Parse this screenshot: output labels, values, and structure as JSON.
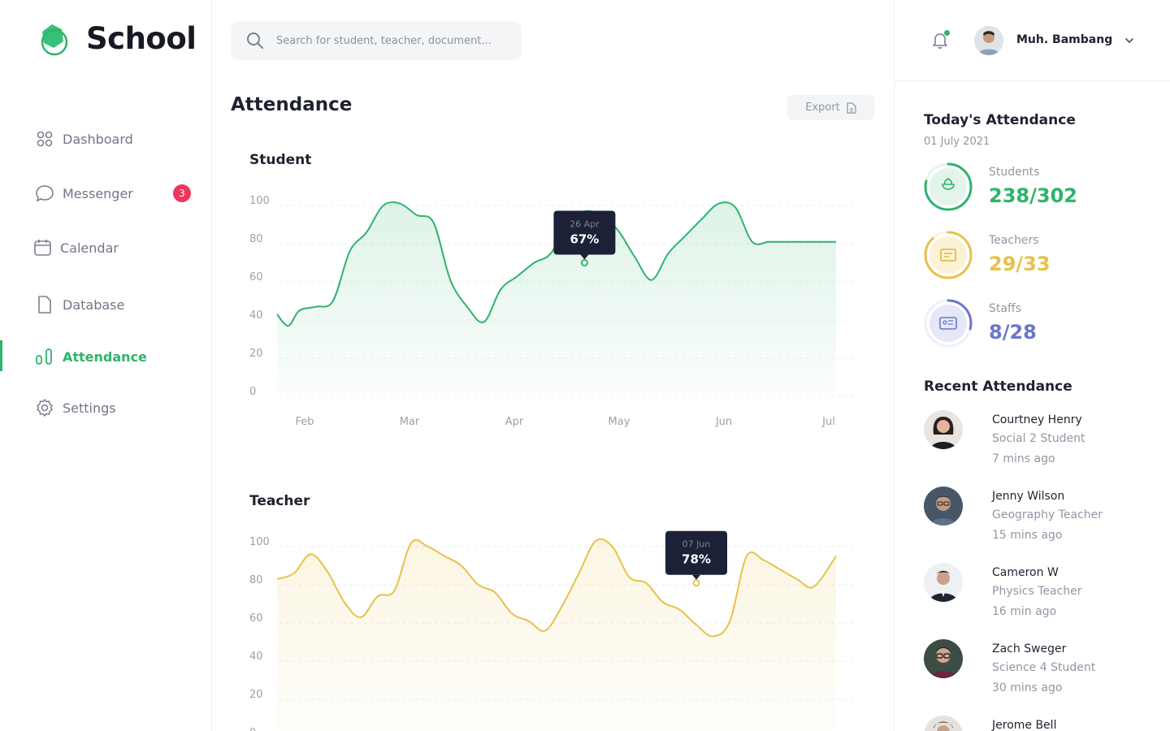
{
  "brand": {
    "name": "School",
    "accent": "#2fb36b"
  },
  "sidebar": {
    "items": [
      {
        "label": "Dashboard",
        "icon": "grid-icon",
        "active": false
      },
      {
        "label": "Messenger",
        "icon": "chat-bubble-icon",
        "active": false,
        "badge": "3"
      },
      {
        "label": "Calendar",
        "icon": "calendar-icon",
        "active": false
      },
      {
        "label": "Database",
        "icon": "file-icon",
        "active": false
      },
      {
        "label": "Attendance",
        "icon": "bar-chart-icon",
        "active": true
      },
      {
        "label": "Settings",
        "icon": "gear-icon",
        "active": false
      }
    ]
  },
  "search": {
    "placeholder": "Search for student, teacher, document...",
    "value": ""
  },
  "page": {
    "title": "Attendance",
    "export_label": "Export"
  },
  "header": {
    "user_name": "Muh. Bambang",
    "notification_dot": true
  },
  "chart_data": [
    {
      "type": "area",
      "title": "Student",
      "color": "#2fb36b",
      "x_ticks": [
        "Feb",
        "Mar",
        "Apr",
        "May",
        "Jun",
        "Jul"
      ],
      "y_ticks": [
        "100",
        "80",
        "60",
        "40",
        "20",
        "0"
      ],
      "ylim": [
        0,
        100
      ],
      "x": [
        0,
        0.1,
        0.2,
        0.35,
        0.5,
        0.65,
        0.8,
        0.95,
        1.1,
        1.25,
        1.4,
        1.55,
        1.7,
        1.85,
        2.0,
        2.15,
        2.3,
        2.45,
        2.6,
        2.75,
        2.9,
        3.05,
        3.2,
        3.35,
        3.5,
        3.65,
        3.8,
        3.95,
        4.1,
        4.25,
        4.4,
        4.55,
        4.7,
        4.85,
        5.0
      ],
      "values": [
        40,
        34,
        42,
        44,
        47,
        73,
        83,
        97,
        98,
        92,
        88,
        58,
        44,
        36,
        53,
        60,
        67,
        72,
        89,
        94,
        92,
        84,
        70,
        58,
        72,
        81,
        90,
        98,
        96,
        78,
        78,
        78,
        78,
        78,
        78
      ],
      "tooltip": {
        "date": "26 Apr",
        "value": "67%",
        "x": 2.75,
        "y": 67
      }
    },
    {
      "type": "area",
      "title": "Teacher",
      "color": "#e8c14a",
      "x_ticks": [],
      "y_ticks": [
        "100",
        "80",
        "60",
        "40",
        "20",
        "0"
      ],
      "ylim": [
        0,
        100
      ],
      "x": [
        0,
        0.15,
        0.3,
        0.45,
        0.6,
        0.75,
        0.9,
        1.05,
        1.2,
        1.35,
        1.5,
        1.65,
        1.8,
        1.95,
        2.1,
        2.25,
        2.4,
        2.55,
        2.7,
        2.85,
        3.0,
        3.15,
        3.3,
        3.45,
        3.6,
        3.75,
        3.9,
        4.05,
        4.2,
        4.35,
        4.5,
        4.65,
        4.8,
        5.0
      ],
      "values": [
        80,
        83,
        93,
        84,
        68,
        60,
        71,
        74,
        99,
        97,
        92,
        87,
        77,
        73,
        62,
        58,
        53,
        66,
        83,
        100,
        97,
        81,
        78,
        68,
        64,
        56,
        50,
        58,
        92,
        90,
        85,
        80,
        76,
        92
      ],
      "tooltip": {
        "date": "07 Jun",
        "value": "78%",
        "x": 3.75,
        "y": 78
      }
    }
  ],
  "today": {
    "title": "Today's Attendance",
    "date": "01 July 2021",
    "stats": [
      {
        "label": "Students",
        "value": "238/302",
        "fraction": 0.79,
        "color": "#2fb36b",
        "icon": "flower-icon"
      },
      {
        "label": "Teachers",
        "value": "29/33",
        "fraction": 0.88,
        "color": "#e8c14a",
        "icon": "certificate-icon"
      },
      {
        "label": "Staffs",
        "value": "8/28",
        "fraction": 0.29,
        "color": "#6b78c8",
        "icon": "id-card-icon"
      }
    ]
  },
  "recent": {
    "title": "Recent Attendance",
    "items": [
      {
        "name": "Courtney Henry",
        "role": "Social 2 Student",
        "time": "7 mins ago",
        "avatar": "avatar-woman"
      },
      {
        "name": "Jenny Wilson",
        "role": "Geography Teacher",
        "time": "15 mins ago",
        "avatar": "avatar-man-glasses"
      },
      {
        "name": "Cameron W",
        "role": "Physics Teacher",
        "time": "16 min ago",
        "avatar": "avatar-man-suit"
      },
      {
        "name": "Zach Sweger",
        "role": "Science 4 Student",
        "time": "30 mins ago",
        "avatar": "avatar-man-glasses-2"
      },
      {
        "name": "Jerome Bell",
        "role": "",
        "time": "",
        "avatar": "avatar-man"
      }
    ]
  }
}
